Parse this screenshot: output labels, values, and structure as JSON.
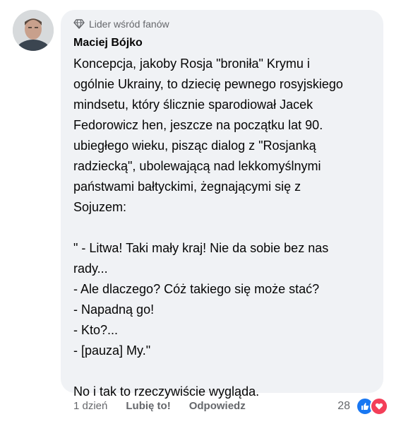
{
  "comment": {
    "badge": "Lider wśród fanów",
    "author": "Maciej Bójko",
    "text": "Koncepcja, jakoby Rosja \"broniła\" Krymu i\nogólnie Ukrainy, to dziecię pewnego rosyjskiego\nmindsetu, który ślicznie sparodiował Jacek\nFedorowicz hen, jeszcze na początku lat 90.\nubiegłego wieku, pisząc dialog z \"Rosjanką\nradziecką\", ubolewającą nad lekkomyślnymi\npaństwami bałtyckimi, żegnającymi się z\nSojuzem:\n\n\" - Litwa! Taki mały kraj! Nie da sobie bez nas\nrady...\n- Ale dlaczego? Cóż takiego się może stać?\n- Napadną go!\n- Kto?...\n- [pauza] My.\"\n\nNo i tak to rzeczywiście wygląda."
  },
  "actions": {
    "time": "1 dzień",
    "like": "Lubię to!",
    "reply": "Odpowiedz"
  },
  "reactions": {
    "count": "28",
    "icons": [
      "like-icon",
      "love-icon"
    ],
    "colors": {
      "like": "#1877f2",
      "love": "#f33e58"
    }
  },
  "colors": {
    "bubble": "#f0f2f5",
    "secondary_text": "#65676b",
    "primary_text": "#050505"
  }
}
